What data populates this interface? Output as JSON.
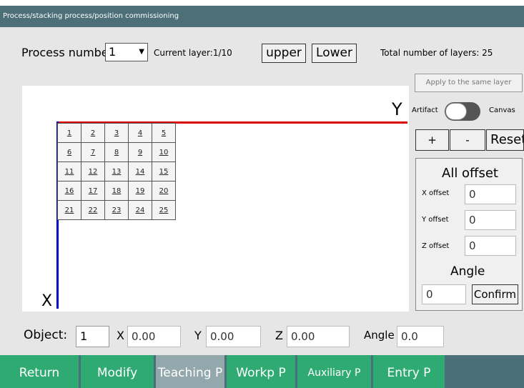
{
  "title": "Process/stacking process/position commissioning",
  "process_label": "Process numbe",
  "process_value": "1",
  "current_layer": "Current layer:1/10",
  "upper_label": "upper",
  "lower_label": "Lower",
  "total_layers": "Total number of layers: 25",
  "apply_label": "Apply to the same layer",
  "artifact_label": "Artifact",
  "canvas_label": "Canvas",
  "plus_label": "+",
  "minus_label": "-",
  "reset_label": "Reset",
  "axis_y_label": "Y",
  "axis_x_label": "X",
  "grid_cells": [
    [
      "1",
      "2",
      "3",
      "4",
      "5"
    ],
    [
      "6",
      "7",
      "8",
      "9",
      "10"
    ],
    [
      "11",
      "12",
      "13",
      "14",
      "15"
    ],
    [
      "16",
      "17",
      "18",
      "19",
      "20"
    ],
    [
      "21",
      "22",
      "23",
      "24",
      "25"
    ]
  ],
  "offset": {
    "title": "All offset",
    "x_label": "X offset",
    "x_value": "0",
    "y_label": "Y offset",
    "y_value": "0",
    "z_label": "Z offset",
    "z_value": "0",
    "angle_title": "Angle",
    "angle_value": "0",
    "confirm_label": "Confirm"
  },
  "object": {
    "label": "Object:",
    "value": "1",
    "x_label": "X",
    "x_value": "0.00",
    "y_label": "Y",
    "y_value": "0.00",
    "z_label": "Z",
    "z_value": "0.00",
    "angle_label": "Angle",
    "angle_value": "0.0"
  },
  "nav": {
    "return": "Return",
    "modify": "Modify",
    "teaching": "Teaching P",
    "workp": "Workp P",
    "auxiliary": "Auxiliary P",
    "entry": "Entry P"
  },
  "colors": {
    "titlebar": "#4d6f78",
    "nav_green": "#2faa73",
    "nav_active": "#93a8ac",
    "axis_x": "#d00000",
    "axis_y": "#0000c8"
  }
}
